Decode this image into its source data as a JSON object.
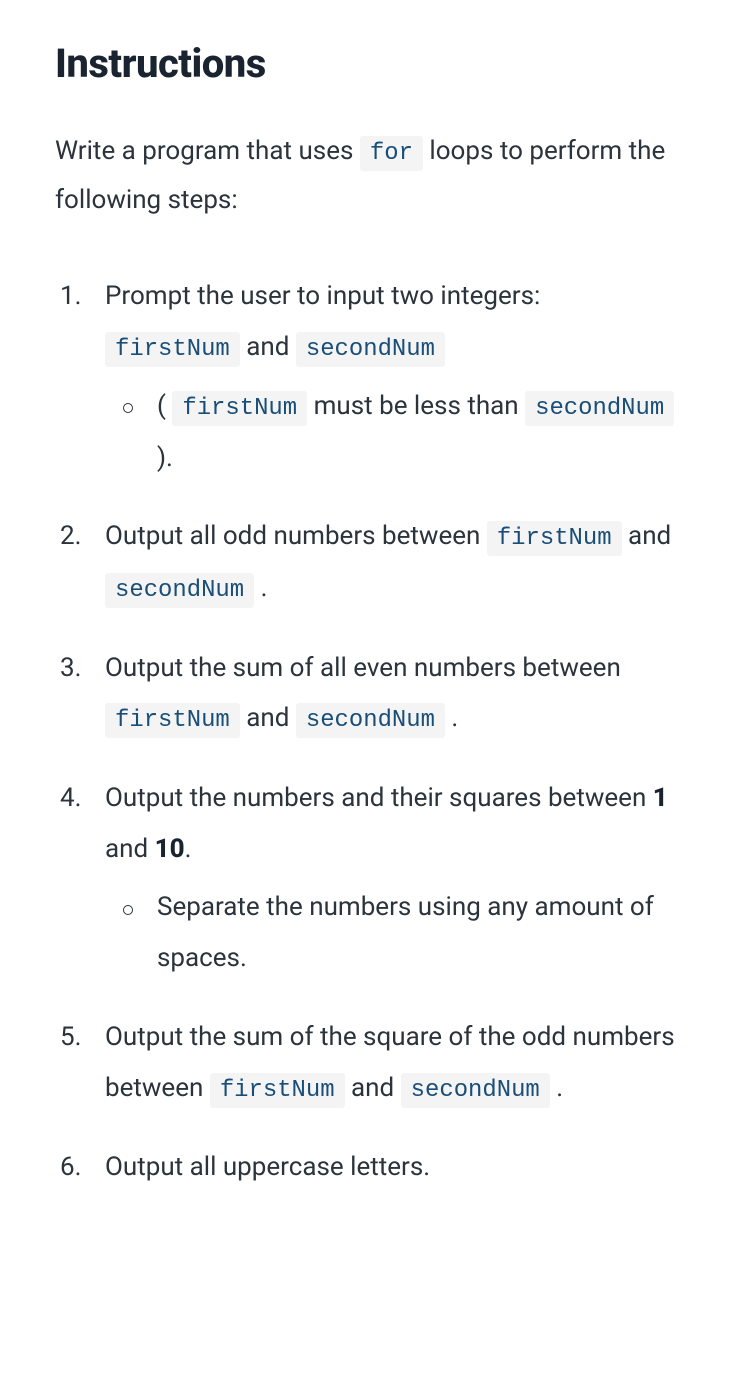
{
  "title": "Instructions",
  "intro": {
    "part1": "Write a program that uses ",
    "code": "for",
    "part2": " loops to perform the following steps:"
  },
  "steps": [
    {
      "segments": [
        {
          "type": "text",
          "value": "Prompt the user to input two integers: "
        },
        {
          "type": "code",
          "value": "firstNum"
        },
        {
          "type": "text",
          "value": " and "
        },
        {
          "type": "code",
          "value": "secondNum"
        }
      ],
      "sub": [
        {
          "segments": [
            {
              "type": "text",
              "value": "( "
            },
            {
              "type": "code",
              "value": "firstNum"
            },
            {
              "type": "text",
              "value": " must be less than "
            },
            {
              "type": "code",
              "value": "secondNum"
            },
            {
              "type": "text",
              "value": " )."
            }
          ]
        }
      ]
    },
    {
      "segments": [
        {
          "type": "text",
          "value": "Output all odd numbers between "
        },
        {
          "type": "code",
          "value": "firstNum"
        },
        {
          "type": "text",
          "value": " and "
        },
        {
          "type": "code",
          "value": "secondNum"
        },
        {
          "type": "text",
          "value": " ."
        }
      ]
    },
    {
      "segments": [
        {
          "type": "text",
          "value": "Output the sum of all even numbers between "
        },
        {
          "type": "code",
          "value": "firstNum"
        },
        {
          "type": "text",
          "value": " and "
        },
        {
          "type": "code",
          "value": "secondNum"
        },
        {
          "type": "text",
          "value": " ."
        }
      ]
    },
    {
      "segments": [
        {
          "type": "text",
          "value": "Output the numbers and their squares between "
        },
        {
          "type": "strong",
          "value": "1"
        },
        {
          "type": "text",
          "value": " and "
        },
        {
          "type": "strong",
          "value": "10"
        },
        {
          "type": "text",
          "value": "."
        }
      ],
      "sub": [
        {
          "segments": [
            {
              "type": "text",
              "value": "Separate the numbers using any amount of spaces."
            }
          ]
        }
      ]
    },
    {
      "segments": [
        {
          "type": "text",
          "value": "Output the sum of the square of the odd numbers between "
        },
        {
          "type": "code",
          "value": "firstNum"
        },
        {
          "type": "text",
          "value": " and "
        },
        {
          "type": "code",
          "value": "secondNum"
        },
        {
          "type": "text",
          "value": " ."
        }
      ]
    },
    {
      "segments": [
        {
          "type": "text",
          "value": "Output all uppercase letters."
        }
      ]
    }
  ]
}
